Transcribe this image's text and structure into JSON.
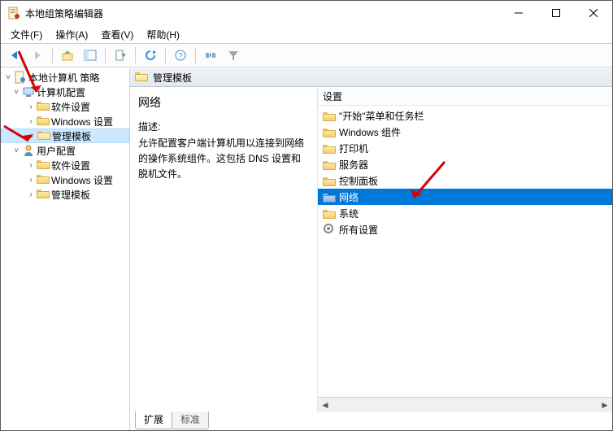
{
  "window": {
    "title": "本地组策略编辑器"
  },
  "menubar": {
    "file": "文件(F)",
    "action": "操作(A)",
    "view": "查看(V)",
    "help": "帮助(H)"
  },
  "tree": {
    "root": "本地计算机 策略",
    "computer_cfg": "计算机配置",
    "software_settings": "软件设置",
    "windows_settings": "Windows 设置",
    "admin_templates": "管理模板",
    "user_cfg": "用户配置"
  },
  "right": {
    "header": "管理模板",
    "heading": "网络",
    "desc_label": "描述:",
    "description": "允许配置客户端计算机用以连接到网络的操作系统组件。这包括 DNS 设置和脱机文件。",
    "col_header": "设置",
    "items": {
      "start_menu": "\"开始\"菜单和任务栏",
      "windows_components": "Windows 组件",
      "printers": "打印机",
      "servers": "服务器",
      "control_panel": "控制面板",
      "network": "网络",
      "system": "系统",
      "all_settings": "所有设置"
    }
  },
  "tabs": {
    "extended": "扩展",
    "standard": "标准"
  }
}
